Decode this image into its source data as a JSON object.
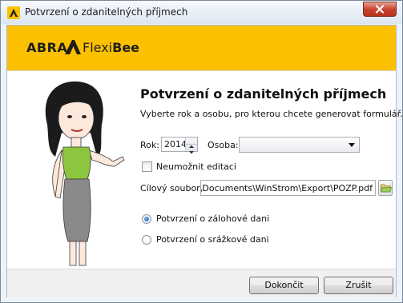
{
  "window": {
    "title": "Potvrzení o zdanitelných příjmech",
    "icon": "abra-flexibee-app-icon",
    "close_icon": "close-icon"
  },
  "banner": {
    "logo_abra": "ABRA",
    "logo_flexi": "Flexi",
    "logo_bee": "Bee",
    "color": "#fbc100"
  },
  "form": {
    "heading": "Potvrzení o zdanitelných příjmech",
    "subtitle": "Vyberte rok a osobu, pro kterou chcete generovat formulář.",
    "year_label": "Rok:",
    "year_value": "2014",
    "person_label": "Osoba:",
    "person_value": "",
    "disable_edit_label": "Neumožnit editaci",
    "disable_edit_checked": false,
    "target_file_label": "Cílový soubor:",
    "target_file_value": "lova\\Documents\\WinStrom\\Export\\POZP.pdf",
    "radio_advance_label": "Potvrzení o zálohové dani",
    "radio_advance_selected": true,
    "radio_withholding_label": "Potvrzení o srážkové dani",
    "radio_withholding_selected": false
  },
  "buttons": {
    "ok": "Dokončit",
    "cancel": "Zrušit"
  }
}
